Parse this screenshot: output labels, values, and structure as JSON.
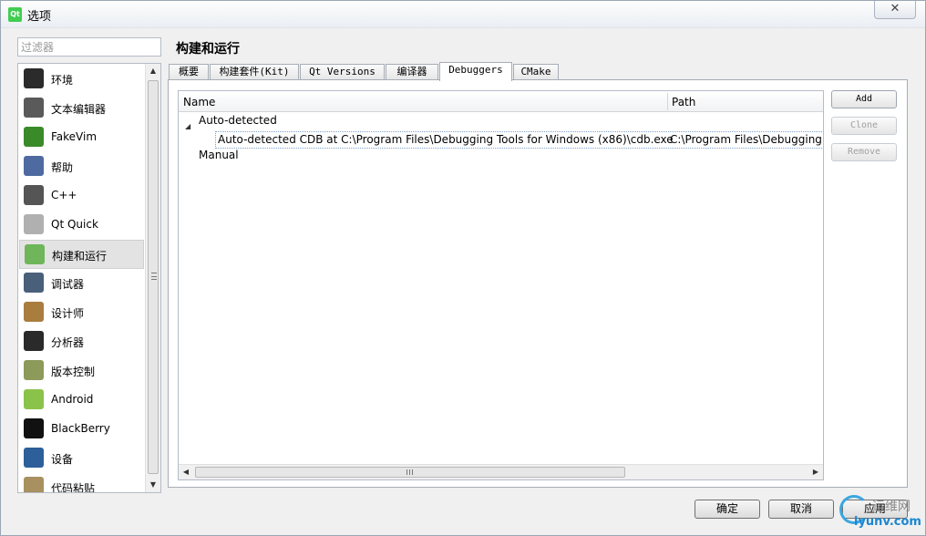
{
  "window": {
    "title": "选项",
    "app_icon": "Qt",
    "close_glyph": "✕"
  },
  "filter": {
    "placeholder": "过滤器"
  },
  "nav": {
    "items": [
      {
        "label": "环境",
        "icon": "environment-icon",
        "color": "#2b2b2b"
      },
      {
        "label": "文本编辑器",
        "icon": "text-editor-icon",
        "color": "#5a5a5a"
      },
      {
        "label": "FakeVim",
        "icon": "fakevim-icon",
        "color": "#3a8a2a"
      },
      {
        "label": "帮助",
        "icon": "help-icon",
        "color": "#4e6aa0"
      },
      {
        "label": "C++",
        "icon": "cpp-icon",
        "color": "#555555"
      },
      {
        "label": "Qt Quick",
        "icon": "qt-quick-icon",
        "color": "#b0b0b0"
      },
      {
        "label": "构建和运行",
        "icon": "build-run-icon",
        "color": "#6fb65a",
        "active": true
      },
      {
        "label": "调试器",
        "icon": "debugger-icon",
        "color": "#4a5f7a"
      },
      {
        "label": "设计师",
        "icon": "designer-icon",
        "color": "#a87d3e"
      },
      {
        "label": "分析器",
        "icon": "analyzer-icon",
        "color": "#2a2a2a"
      },
      {
        "label": "版本控制",
        "icon": "version-control-icon",
        "color": "#8c9a5a"
      },
      {
        "label": "Android",
        "icon": "android-icon",
        "color": "#8bc34a"
      },
      {
        "label": "BlackBerry",
        "icon": "blackberry-icon",
        "color": "#111111"
      },
      {
        "label": "设备",
        "icon": "devices-icon",
        "color": "#2d5f9a"
      },
      {
        "label": "代码粘贴",
        "icon": "code-paste-icon",
        "color": "#a89060"
      }
    ]
  },
  "page": {
    "title": "构建和运行",
    "tabs": [
      "概要",
      "构建套件(Kit)",
      "Qt Versions",
      "编译器",
      "Debuggers",
      "CMake"
    ],
    "active_tab": "Debuggers"
  },
  "debuggers": {
    "columns": {
      "name": "Name",
      "path": "Path"
    },
    "groups": {
      "auto": "Auto-detected",
      "manual": "Manual"
    },
    "entry": {
      "name": "Auto-detected CDB at C:\\Program Files\\Debugging Tools for Windows (x86)\\cdb.exe",
      "path": "C:\\Program Files\\Debugging"
    },
    "buttons": {
      "add": "Add",
      "clone": "Clone",
      "remove": "Remove"
    }
  },
  "footer": {
    "ok": "确定",
    "cancel": "取消",
    "apply": "应用"
  },
  "watermark": {
    "cn": "运维网",
    "url": "iyunv.com"
  }
}
